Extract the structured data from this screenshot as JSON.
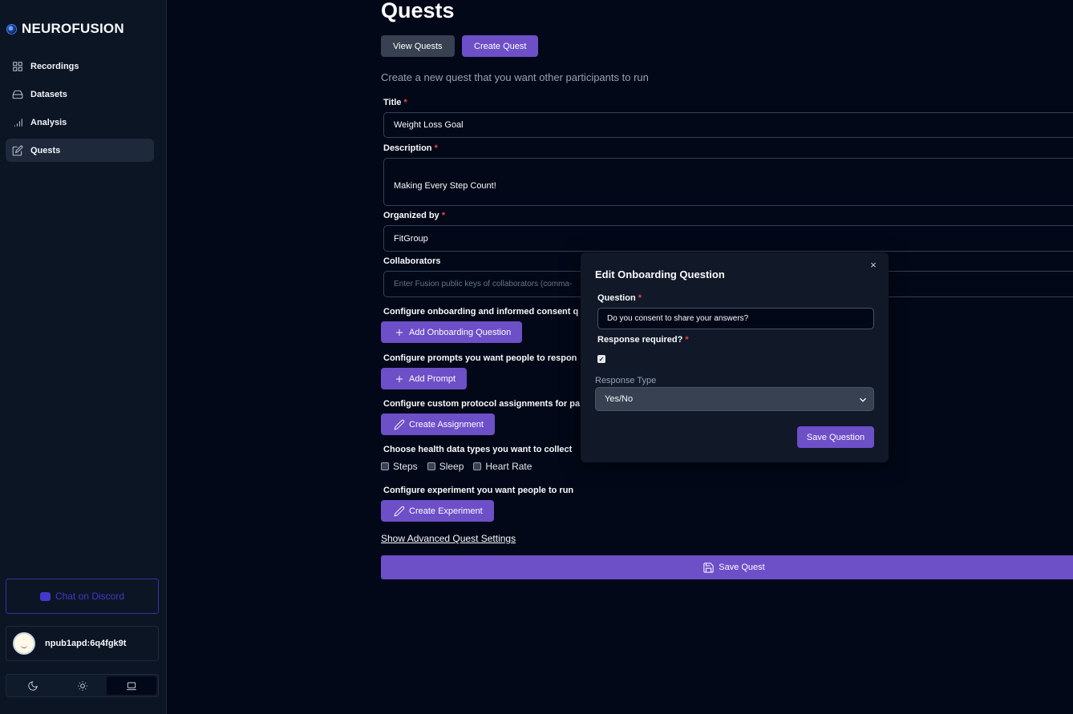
{
  "brand": {
    "name": "NEUROFUSION",
    "logo_icon": "neurofusion-logo-icon"
  },
  "sidebar": {
    "items": [
      {
        "label": "Recordings",
        "icon": "grid-icon"
      },
      {
        "label": "Datasets",
        "icon": "hard-drive-icon"
      },
      {
        "label": "Analysis",
        "icon": "bar-chart-icon"
      },
      {
        "label": "Quests",
        "icon": "edit-icon",
        "active": true
      }
    ],
    "discord_label": "Chat on Discord",
    "user_name": "npub1apd:6q4fgk9t",
    "theme_options": [
      "moon-icon",
      "sun-icon",
      "laptop-icon"
    ]
  },
  "main": {
    "title": "Quests",
    "tabs": {
      "view": "View Quests",
      "create": "Create Quest"
    },
    "subtitle": "Create a new quest that you want other participants to run",
    "title_label": "Title",
    "title_value": "Weight Loss Goal",
    "description_label": "Description",
    "description_value": "Making Every Step Count!",
    "organizer_label": "Organized by",
    "organizer_value": "FitGroup",
    "collaborators_label": "Collaborators",
    "collaborators_placeholder": "Enter Fusion public keys of collaborators (comma-",
    "onboarding_label": "Configure onboarding and informed consent q",
    "onboarding_button": "Add Onboarding Question",
    "prompts_label": "Configure prompts you want people to respon",
    "prompts_button": "Add Prompt",
    "assignment_label": "Configure custom protocol assignments for pa",
    "assignment_button": "Create Assignment",
    "health_label": "Choose health data types you want to collect",
    "health_options": [
      "Steps",
      "Sleep",
      "Heart Rate"
    ],
    "experiment_label": "Configure experiment you want people to run",
    "experiment_button": "Create Experiment",
    "advanced_link": "Show Advanced Quest Settings",
    "save_button": "Save Quest",
    "required_mark": "*"
  },
  "modal": {
    "title": "Edit Onboarding Question",
    "close": "×",
    "question_label": "Question",
    "question_value": "Do you consent to share your answers?",
    "required_label": "Response required?",
    "required_checked": true,
    "check_mark": "✓",
    "response_type_label": "Response Type",
    "response_type_value": "Yes/No",
    "save_button": "Save Question"
  },
  "colors": {
    "accent": "#6d4fc8",
    "background": "#020817",
    "sidebar": "#0c1524",
    "required": "#ef4444"
  }
}
